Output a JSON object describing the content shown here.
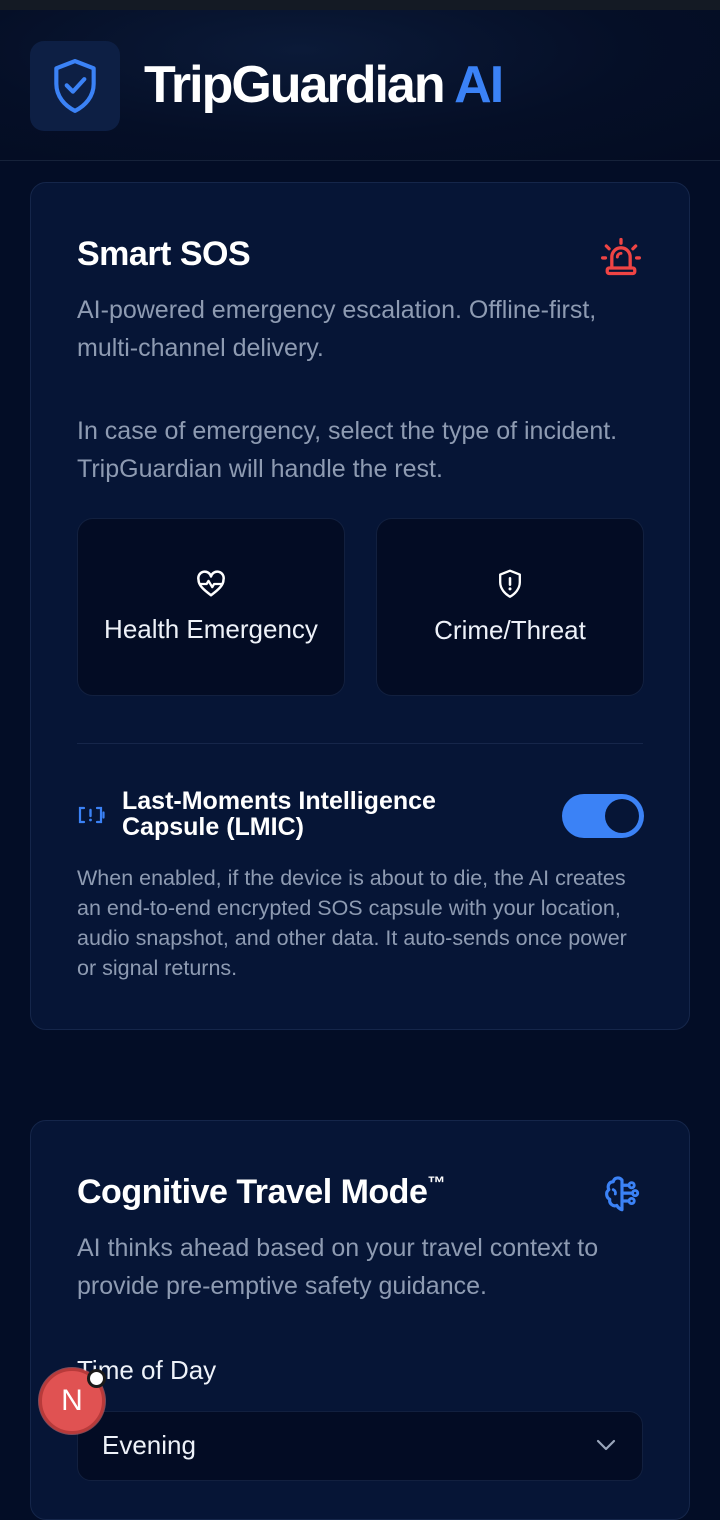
{
  "app": {
    "name": "TripGuardian",
    "name_suffix": "AI"
  },
  "sos": {
    "title": "Smart SOS",
    "subtitle": "AI-powered emergency escalation. Offline-first, multi-channel delivery.",
    "instructions": "In case of emergency, select the type of incident. TripGuardian will handle the rest.",
    "options": [
      {
        "label": "Health Emergency",
        "icon": "heart-pulse-icon"
      },
      {
        "label": "Crime/Threat",
        "icon": "shield-alert-icon"
      }
    ],
    "lmic": {
      "title": "Last-Moments Intelligence Capsule (LMIC)",
      "enabled": true,
      "description": "When enabled, if the device is about to die, the AI creates an end-to-end encrypted SOS capsule with your location, audio snapshot, and other data. It auto-sends once power or signal returns."
    }
  },
  "cognitive": {
    "title": "Cognitive Travel Mode",
    "title_mark": "™",
    "subtitle": "AI thinks ahead based on your travel context to provide pre-emptive safety guidance.",
    "time_of_day": {
      "label": "Time of Day",
      "value": "Evening"
    }
  },
  "user": {
    "initial": "N"
  },
  "colors": {
    "accent": "#3b82f6",
    "alert": "#ef4444",
    "background": "#030d26",
    "card": "#061536"
  }
}
